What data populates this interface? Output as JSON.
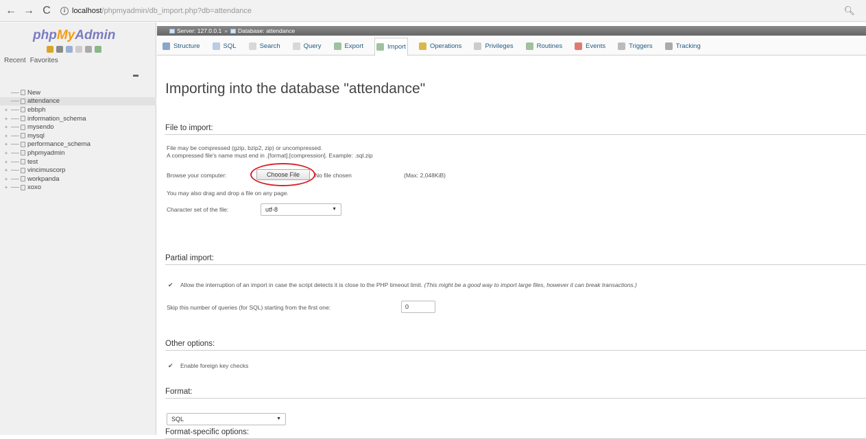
{
  "browser": {
    "back": "←",
    "forward": "→",
    "reload": "C",
    "url_host": "localhost",
    "url_path": "/phpmyadmin/db_import.php?db=attendance"
  },
  "sidebar": {
    "logo": {
      "php": "php",
      "my": "My",
      "admin": "Admin"
    },
    "recent": "Recent",
    "favorites": "Favorites",
    "tree": [
      {
        "label": "New",
        "expander": ""
      },
      {
        "label": "attendance",
        "expander": "",
        "active": true
      },
      {
        "label": "ebbph",
        "expander": "+"
      },
      {
        "label": "information_schema",
        "expander": "+"
      },
      {
        "label": "mysendo",
        "expander": "+"
      },
      {
        "label": "mysql",
        "expander": "+"
      },
      {
        "label": "performance_schema",
        "expander": "+"
      },
      {
        "label": "phpmyadmin",
        "expander": "+"
      },
      {
        "label": "test",
        "expander": "+"
      },
      {
        "label": "vincimuscorp",
        "expander": "+"
      },
      {
        "label": "workpanda",
        "expander": "+"
      },
      {
        "label": "xoxo",
        "expander": "+"
      }
    ]
  },
  "breadcrumb": {
    "server": "Server: 127.0.0.1",
    "database": "Database: attendance"
  },
  "tabs": [
    {
      "label": "Structure",
      "color": "#8aa6c8"
    },
    {
      "label": "SQL",
      "color": "#b9cce4"
    },
    {
      "label": "Search",
      "color": "#d8d8d8"
    },
    {
      "label": "Query",
      "color": "#d8d8d8"
    },
    {
      "label": "Export",
      "color": "#9ec29e"
    },
    {
      "label": "Import",
      "color": "#9ec29e",
      "active": true
    },
    {
      "label": "Operations",
      "color": "#d8b84a"
    },
    {
      "label": "Privileges",
      "color": "#cccccc"
    },
    {
      "label": "Routines",
      "color": "#9ec29e"
    },
    {
      "label": "Events",
      "color": "#e07a6e"
    },
    {
      "label": "Triggers",
      "color": "#bbbbbb"
    },
    {
      "label": "Tracking",
      "color": "#aaaaaa"
    }
  ],
  "page_title": "Importing into the database \"attendance\"",
  "file_import": {
    "title": "File to import:",
    "line1": "File may be compressed (gzip, bzip2, zip) or uncompressed.",
    "line2": "A compressed file's name must end in .[format].[compression]. Example: .sql.zip",
    "browse_label": "Browse your computer:",
    "choose_button": "Choose File",
    "no_file": "No file chosen",
    "max": "(Max: 2,048KiB)",
    "drag_text": "You may also drag and drop a file on any page.",
    "charset_label": "Character set of the file:",
    "charset_value": "utf-8"
  },
  "partial_import": {
    "title": "Partial import:",
    "allow_text": "Allow the interruption of an import in case the script detects it is close to the PHP timeout limit.",
    "allow_note": "(This might be a good way to import large files, however it can break transactions.)",
    "skip_label": "Skip this number of queries (for SQL) starting from the first one:",
    "skip_value": "0"
  },
  "other_options": {
    "title": "Other options:",
    "fk_text": "Enable foreign key checks"
  },
  "format": {
    "title": "Format:",
    "value": "SQL"
  },
  "format_specific": {
    "title": "Format-specific options:"
  }
}
